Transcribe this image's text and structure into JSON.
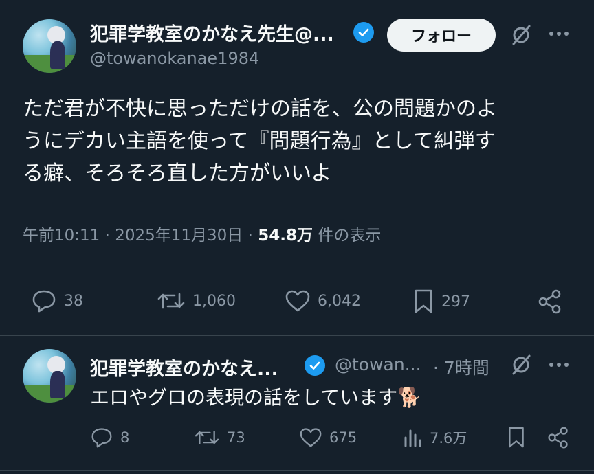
{
  "main_tweet": {
    "display_name": "犯罪学教室のかなえ先生@...",
    "handle": "@towanokanae1984",
    "follow_label": "フォロー",
    "text_lines": [
      "ただ君が不快に思っただけの話を、公の問題かのよ",
      "うにデカい主語を使って『問題行為』として糾弾す",
      "る癖、そろそろ直した方がいいよ"
    ],
    "time": "午前10:11",
    "date": "2025年11月30日",
    "views_count": "54.8万",
    "views_label": "件の表示",
    "replies": "38",
    "retweets": "1,060",
    "likes": "6,042",
    "bookmarks": "297"
  },
  "reply_tweet": {
    "display_name": "犯罪学教室のかなえ...",
    "handle": "@towan...",
    "time_ago": "· 7時間",
    "text": "エロやグロの表現の話をしています",
    "emoji": "🐕",
    "replies": "8",
    "retweets": "73",
    "likes": "675",
    "views": "7.6万"
  },
  "icons": [
    "verified-badge-icon",
    "grok-icon",
    "more-icon",
    "reply-icon",
    "retweet-icon",
    "like-icon",
    "bookmark-icon",
    "share-icon",
    "analytics-icon"
  ],
  "colors": {
    "background": "#15202b",
    "text": "#f7f9f9",
    "muted": "#8b98a5",
    "accent": "#1d9bf0",
    "divider": "#38444d"
  }
}
